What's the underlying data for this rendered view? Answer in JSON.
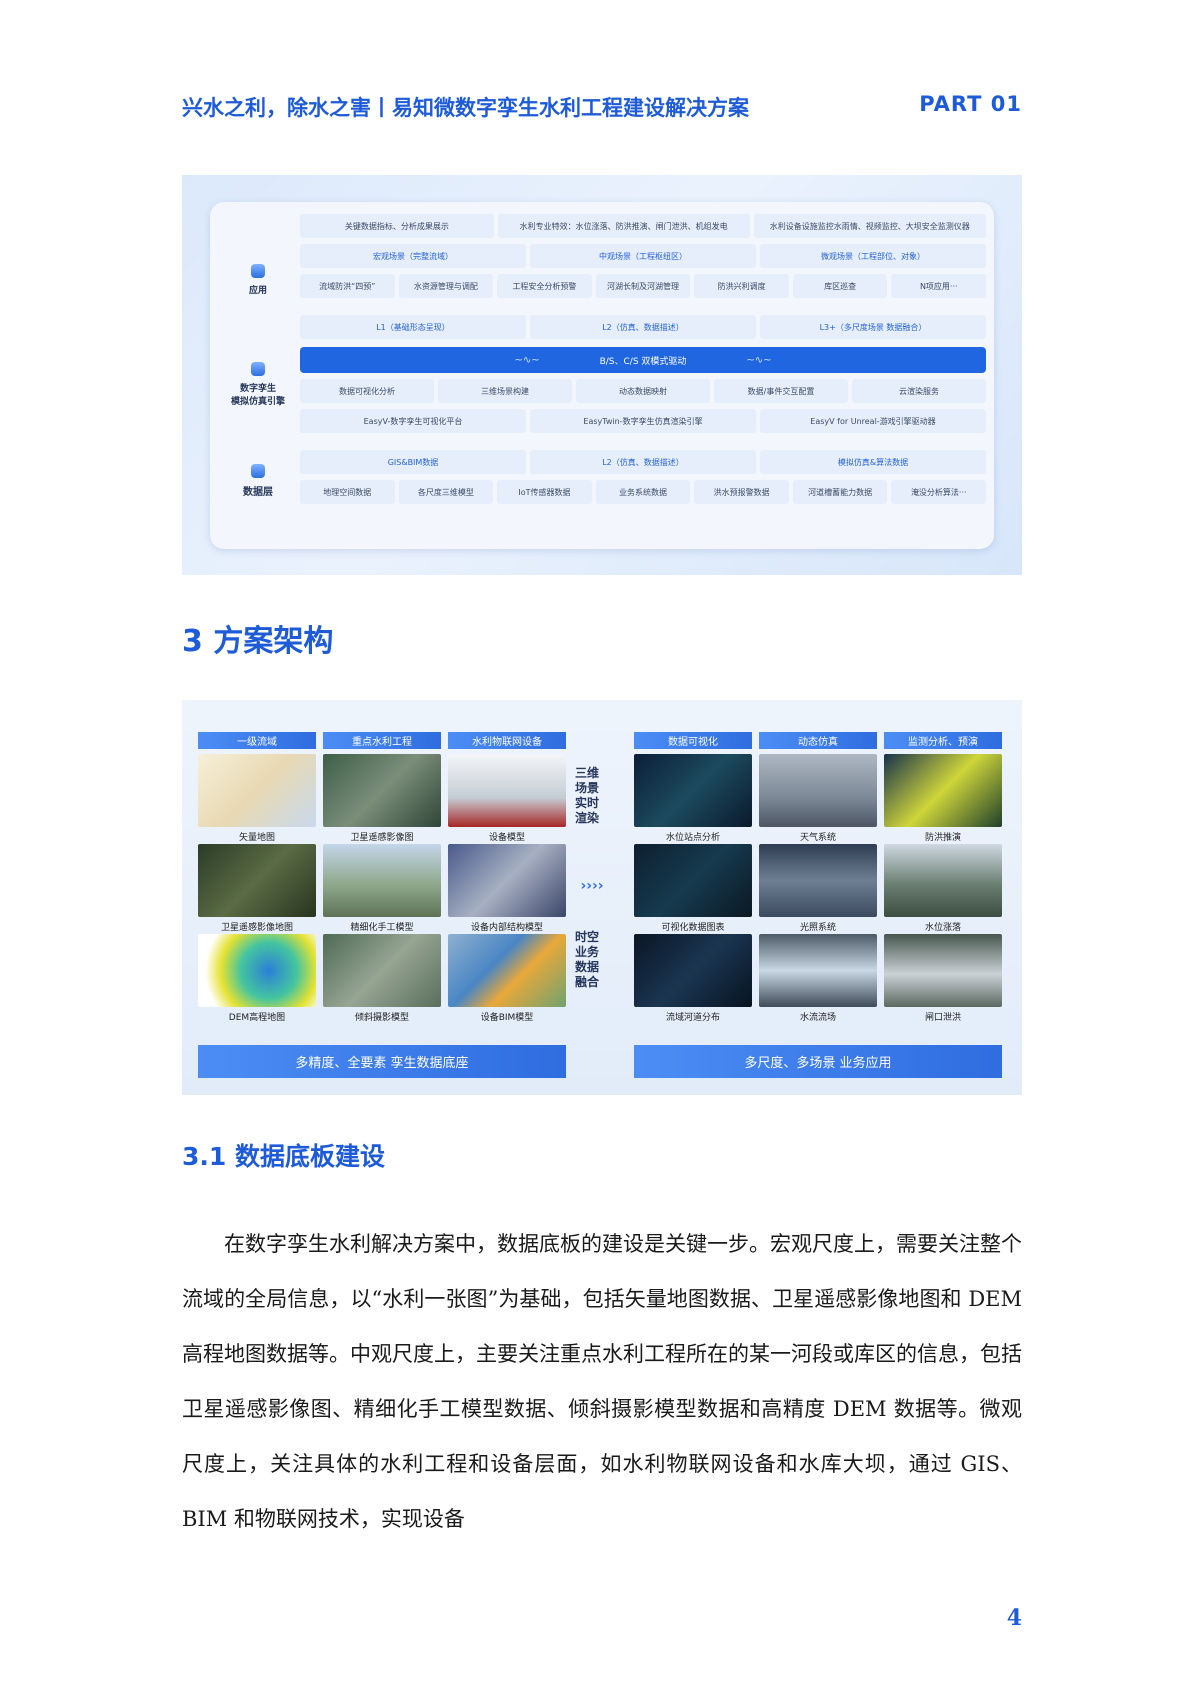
{
  "header": {
    "title": "兴水之利，除水之害丨易知微数字孪生水利工程建设解决方案",
    "part": "PART 01"
  },
  "architecture": {
    "layers": {
      "app": "应用",
      "engine_line1": "数字孪生",
      "engine_line2": "模拟仿真引擎",
      "data": "数据层"
    },
    "row1": [
      "关键数据指标、分析成果展示",
      "水利专业特效：水位涨落、防洪推演、闸门泄洪、机组发电",
      "水利设备设施监控水雨情、视频监控、大坝安全监测仪器"
    ],
    "row2": [
      "宏观场景（完整流域）",
      "中观场景（工程枢纽区）",
      "微观场景（工程部位、对象）"
    ],
    "row3": [
      "流域防洪“四预”",
      "水资源管理与调配",
      "工程安全分析预警",
      "河湖长制及河湖管理",
      "防洪兴利调度",
      "库区巡查",
      "N项应用···"
    ],
    "row4": [
      "L1（基础形态呈现）",
      "L2（仿真、数据描述）",
      "L3+（多尺度场景 数据融合）"
    ],
    "bar": "B/S、C/S 双模式驱动",
    "row5": [
      "数据可视化分析",
      "三维场景构建",
      "动态数据映射",
      "数据/事件交互配置",
      "云渲染服务"
    ],
    "row6": [
      "EasyV-数字孪生可视化平台",
      "EasyTwin-数字孪生仿真渲染引擎",
      "EasyV for Unreal-游戏引擎驱动器"
    ],
    "row7": [
      "GIS&BIM数据",
      "L2（仿真、数据描述）",
      "模拟仿真&算法数据"
    ],
    "row8": [
      "地理空间数据",
      "各尺度三维模型",
      "IoT传感器数据",
      "业务系统数据",
      "洪水预报警数据",
      "河道槽蓄能力数据",
      "淹没分析算法···"
    ]
  },
  "section_title": "3 方案架构",
  "flow": {
    "left_headers": [
      "一级流域",
      "重点水利工程",
      "水利物联网设备"
    ],
    "right_headers": [
      "数据可视化",
      "动态仿真",
      "监测分析、预演"
    ],
    "left_captions": [
      "矢量地图",
      "卫星遥感影像图",
      "设备模型",
      "卫星遥感影像地图",
      "精细化手工模型",
      "设备内部结构模型",
      "DEM高程地图",
      "倾斜摄影模型",
      "设备BIM模型"
    ],
    "right_captions": [
      "水位站点分析",
      "天气系统",
      "防洪推演",
      "可视化数据图表",
      "光照系统",
      "水位涨落",
      "流域河道分布",
      "水流流场",
      "闸口泄洪"
    ],
    "mid_top": "三维场景实时渲染",
    "mid_bottom": "时空业务数据融合",
    "arrows": "››››",
    "left_bottom": "多精度、全要素 孪生数据底座",
    "right_bottom": "多尺度、多场景 业务应用"
  },
  "subsection_title": "3.1 数据底板建设",
  "paragraph": "在数字孪生水利解决方案中，数据底板的建设是关键一步。宏观尺度上，需要关注整个流域的全局信息，以“水利一张图”为基础，包括矢量地图数据、卫星遥感影像地图和 DEM 高程地图数据等。中观尺度上，主要关注重点水利工程所在的某一河段或库区的信息，包括卫星遥感影像图、精细化手工模型数据、倾斜摄影模型数据和高精度 DEM 数据等。微观尺度上，关注具体的水利工程和设备层面，如水利物联网设备和水库大坝，通过 GIS、BIM 和物联网技术，实现设备",
  "page_number": "4",
  "colors": {
    "accent": "#1d5bd8",
    "bar": "#1f66e0"
  }
}
